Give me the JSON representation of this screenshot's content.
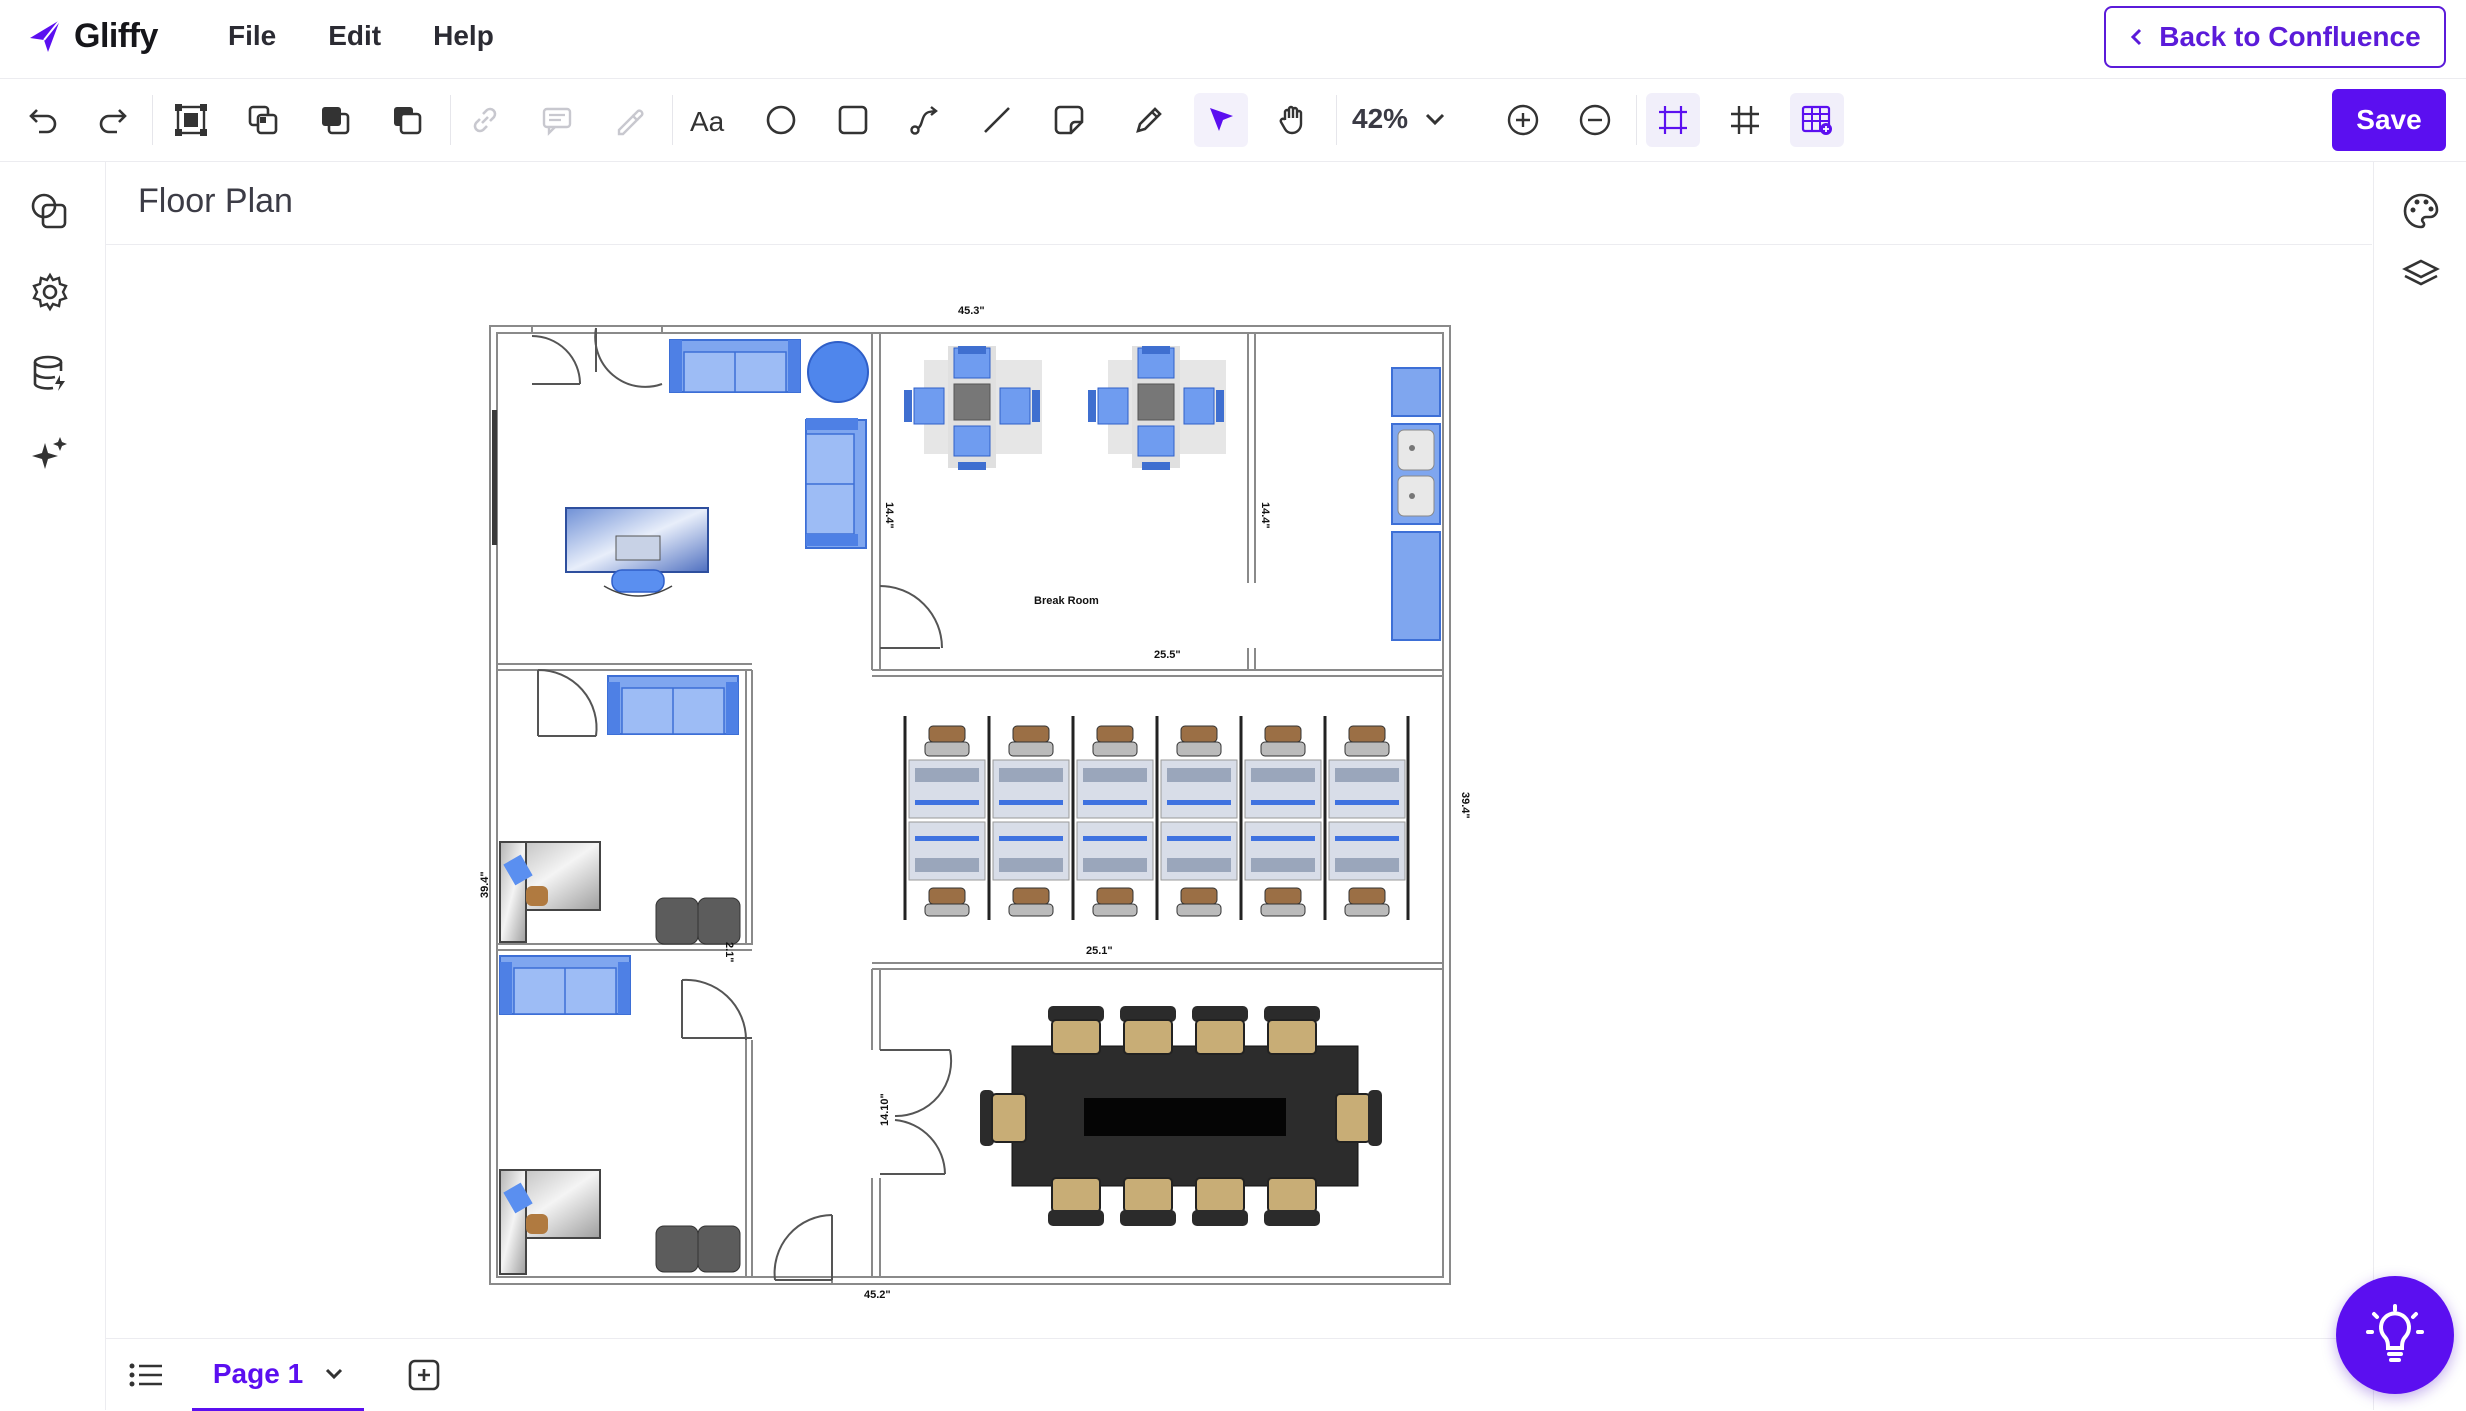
{
  "app": {
    "name": "Gliffy",
    "menu": [
      "File",
      "Edit",
      "Help"
    ],
    "back_label": "Back to Confluence",
    "save_label": "Save",
    "accent_color": "#5b0ff0"
  },
  "toolbar": {
    "zoom": "42%",
    "tools": [
      "undo-icon",
      "redo-icon",
      "group-icon",
      "ungroup-icon",
      "bring-front-icon",
      "send-back-icon",
      "link-icon",
      "comment-icon",
      "dropper-icon",
      "text-icon",
      "ellipse-icon",
      "rectangle-icon",
      "connector-icon",
      "line-icon",
      "sticky-note-icon",
      "pencil-icon",
      "pointer-icon",
      "hand-icon",
      "zoom-in-icon",
      "zoom-out-icon",
      "snap-icon",
      "grid-icon",
      "table-icon"
    ]
  },
  "left_rail": [
    "shapes-icon",
    "settings-icon",
    "data-icon",
    "ai-sparkle-icon"
  ],
  "right_rail": [
    "palette-icon",
    "layers-icon"
  ],
  "document": {
    "title": "Floor Plan"
  },
  "floorplan": {
    "labels": {
      "room": "Break Room",
      "dim_top": "45.3\"",
      "dim_break_bottom": "25.5\"",
      "dim_break_left": "14.4\"",
      "dim_break_right": "14.4\"",
      "dim_right": "39.4\"",
      "dim_left": "39.4\"",
      "dim_office_right": "2.1\"",
      "dim_cubes_bottom": "25.1\"",
      "dim_conf_left": "14.10\"",
      "dim_bottom": "45.2\""
    }
  },
  "pages": {
    "current": "Page 1"
  }
}
